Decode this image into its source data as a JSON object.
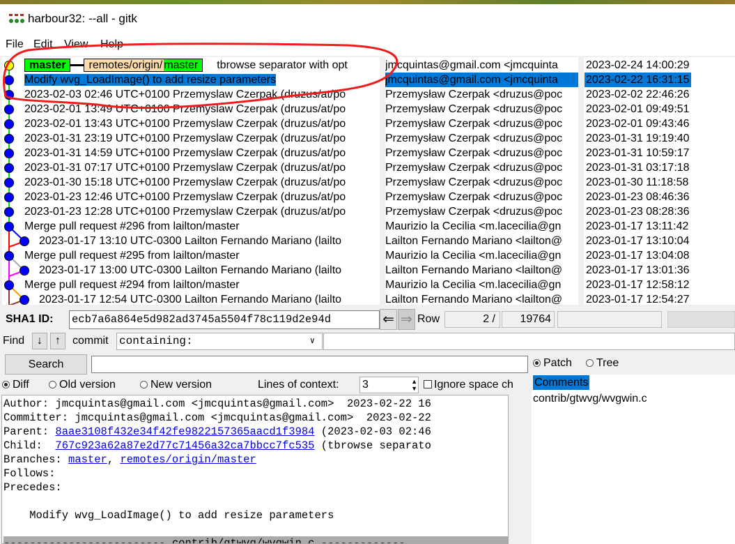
{
  "window": {
    "title": "harbour32: --all - gitk"
  },
  "menu": [
    "File",
    "Edit",
    "View",
    "Help"
  ],
  "refs": {
    "head": "master",
    "remote_prefix": "remotes/origin/",
    "remote_branch": "master"
  },
  "commits": [
    {
      "subject": "tbrowse separator with opt",
      "author": "jmcquintas@gmail.com <jmcquinta",
      "date": "2023-02-24 14:00:29",
      "indent": 0,
      "refs": true
    },
    {
      "subject": "Modify wvg_LoadImage() to add resize parameters",
      "author": "jmcquintas@gmail.com <jmcquinta",
      "date": "2023-02-22 16:31:15",
      "indent": 0,
      "selected": true
    },
    {
      "subject": "2023-02-03 02:46 UTC+0100 Przemyslaw Czerpak (druzus/at/po",
      "author": "Przemysław Czerpak <druzus@poc",
      "date": "2023-02-02 22:46:26",
      "indent": 0
    },
    {
      "subject": "2023-02-01 13:49 UTC+0100 Przemyslaw Czerpak (druzus/at/po",
      "author": "Przemysław Czerpak <druzus@poc",
      "date": "2023-02-01 09:49:51",
      "indent": 0
    },
    {
      "subject": "2023-02-01 13:43 UTC+0100 Przemyslaw Czerpak (druzus/at/po",
      "author": "Przemysław Czerpak <druzus@poc",
      "date": "2023-02-01 09:43:46",
      "indent": 0
    },
    {
      "subject": "2023-01-31 23:19 UTC+0100 Przemyslaw Czerpak (druzus/at/po",
      "author": "Przemysław Czerpak <druzus@poc",
      "date": "2023-01-31 19:19:40",
      "indent": 0
    },
    {
      "subject": "2023-01-31 14:59 UTC+0100 Przemyslaw Czerpak (druzus/at/po",
      "author": "Przemysław Czerpak <druzus@poc",
      "date": "2023-01-31 10:59:17",
      "indent": 0
    },
    {
      "subject": "2023-01-31 07:17 UTC+0100 Przemyslaw Czerpak (druzus/at/po",
      "author": "Przemysław Czerpak <druzus@poc",
      "date": "2023-01-31 03:17:18",
      "indent": 0
    },
    {
      "subject": "2023-01-30 15:18 UTC+0100 Przemyslaw Czerpak (druzus/at/po",
      "author": "Przemysław Czerpak <druzus@poc",
      "date": "2023-01-30 11:18:58",
      "indent": 0
    },
    {
      "subject": "2023-01-23 12:46 UTC+0100 Przemyslaw Czerpak (druzus/at/po",
      "author": "Przemysław Czerpak <druzus@poc",
      "date": "2023-01-23 08:46:36",
      "indent": 0
    },
    {
      "subject": "2023-01-23 12:28 UTC+0100 Przemyslaw Czerpak (druzus/at/po",
      "author": "Przemysław Czerpak <druzus@poc",
      "date": "2023-01-23 08:28:36",
      "indent": 0
    },
    {
      "subject": "Merge pull request #296 from lailton/master",
      "author": "Maurizio la Cecilia <m.lacecilia@gn",
      "date": "2023-01-17 13:11:42",
      "indent": 0
    },
    {
      "subject": "2023-01-17 13:10 UTC-0300 Lailton Fernando Mariano (lailto",
      "author": "Lailton Fernando Mariano <lailton@",
      "date": "2023-01-17 13:10:04",
      "indent": 1
    },
    {
      "subject": "Merge pull request #295 from lailton/master",
      "author": "Maurizio la Cecilia <m.lacecilia@gn",
      "date": "2023-01-17 13:04:08",
      "indent": 0
    },
    {
      "subject": "2023-01-17 13:00 UTC-0300 Lailton Fernando Mariano (lailto",
      "author": "Lailton Fernando Mariano <lailton@",
      "date": "2023-01-17 13:01:36",
      "indent": 1
    },
    {
      "subject": "Merge pull request #294 from lailton/master",
      "author": "Maurizio la Cecilia <m.lacecilia@gn",
      "date": "2023-01-17 12:58:12",
      "indent": 0
    },
    {
      "subject": "2023-01-17 12:54 UTC-0300 Lailton Fernando Mariano (lailto",
      "author": "Lailton Fernando Mariano <lailton@",
      "date": "2023-01-17 12:54:27",
      "indent": 1
    }
  ],
  "sha": {
    "label": "SHA1 ID:",
    "value": "ecb7a6a864e5d982ad3745a5504f78c119d2e94d",
    "row_label": "Row",
    "row": "2 /",
    "total": "19764"
  },
  "find": {
    "label": "Find",
    "type": "commit",
    "mode": "containing:"
  },
  "search": {
    "button": "Search"
  },
  "diffopts": {
    "diff": "Diff",
    "old": "Old version",
    "new": "New version",
    "context_label": "Lines of context:",
    "context": "3",
    "ignore": "Ignore space ch"
  },
  "view": {
    "patch": "Patch",
    "tree": "Tree"
  },
  "files": {
    "comments": "Comments",
    "items": [
      "contrib/gtwvg/wvgwin.c"
    ]
  },
  "details": {
    "author": "Author: jmcquintas@gmail.com <jmcquintas@gmail.com>  2023-02-22 16",
    "committer": "Committer: jmcquintas@gmail.com <jmcquintas@gmail.com>  2023-02-22",
    "parent_label": "Parent: ",
    "parent_hash": "8aae3108f432e34f42fe9822157365aacd1f3984",
    "parent_rest": " (2023-02-03 02:46",
    "child_label": "Child:  ",
    "child_hash": "767c923a62a87e2d77c71456a32ca7bbcc7fc535",
    "child_rest": " (tbrowse separato",
    "branches_label": "Branches: ",
    "branch1": "master",
    "branch_sep": ", ",
    "branch2": "remotes/origin/master",
    "follows": "Follows:",
    "precedes": "Precedes:",
    "message": "    Modify wvg_LoadImage() to add resize parameters",
    "file_header": "------------------------- contrib/gtwvg/wvgwin.c -------------"
  },
  "colors": {
    "selection": "#0078d7",
    "head_tag": "#00ff00",
    "remote_tag": "#ffddaa",
    "node": "#0000ff",
    "link": "#0000ee"
  }
}
